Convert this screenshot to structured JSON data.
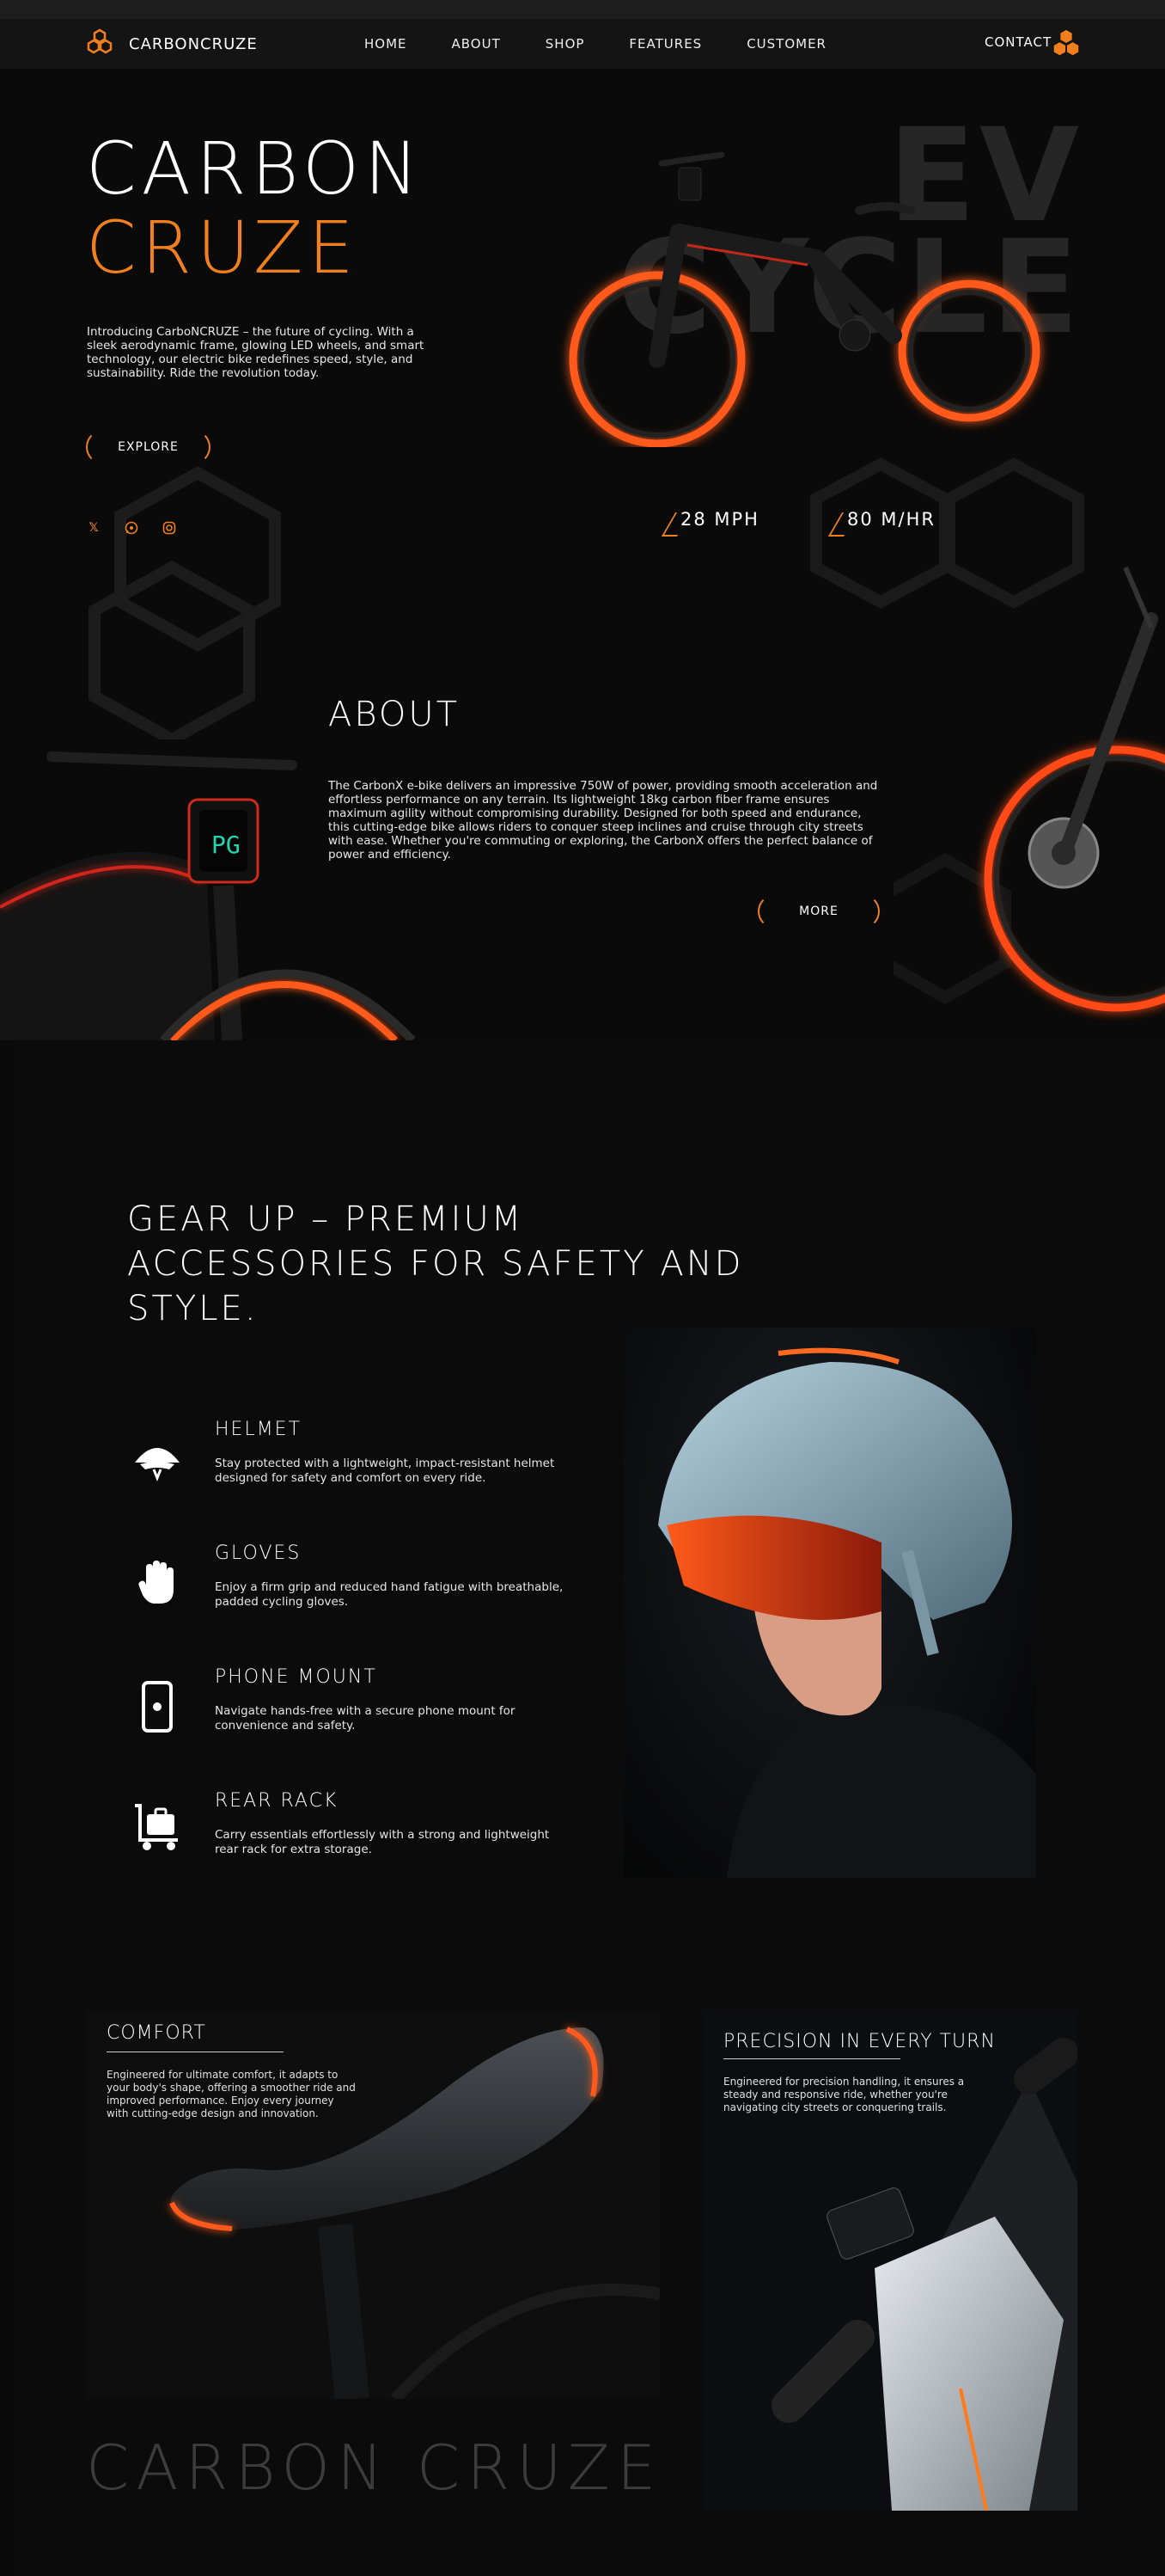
{
  "nav": {
    "brand": "CARBONCRUZE",
    "links": [
      "HOME",
      "ABOUT",
      "SHOP",
      "FEATURES",
      "CUSTOMER"
    ],
    "contact": "CONTACT"
  },
  "hero": {
    "title_line1": "CARBON",
    "title_line2": "CRUZE",
    "description": "Introducing CarboNCRUZE – the future of cycling. With a sleek aerodynamic frame, glowing LED wheels, and smart technology, our electric bike redefines speed, style, and sustainability. Ride the revolution today.",
    "explore_label": "EXPLORE",
    "bg_word_line1": "EV",
    "bg_word_line2": "CYCLE",
    "stats": [
      "28 MPH",
      "80 M/HR"
    ],
    "socials": [
      "x-icon",
      "whatsapp-icon",
      "instagram-icon"
    ]
  },
  "about": {
    "title": "ABOUT",
    "description": "The CarbonX e-bike delivers an impressive 750W of power, providing smooth acceleration and effortless performance on any terrain. Its lightweight 18kg carbon fiber frame ensures maximum agility without compromising durability. Designed for both speed and endurance, this cutting-edge bike allows riders to conquer steep inclines and cruise through city streets with ease. Whether you're commuting or exploring, the CarbonX offers the perfect balance of power and efficiency.",
    "more_label": "MORE",
    "display_text": "PG"
  },
  "gear": {
    "title": "GEAR UP – PREMIUM ACCESSORIES FOR SAFETY AND STYLE.",
    "items": [
      {
        "title": "HELMET",
        "desc": "Stay protected with a lightweight, impact-resistant helmet designed for safety and comfort on every ride.",
        "icon": "helmet-icon"
      },
      {
        "title": "GLOVES",
        "desc": "Enjoy a firm grip and reduced hand fatigue with breathable, padded cycling gloves.",
        "icon": "glove-icon"
      },
      {
        "title": "PHONE MOUNT",
        "desc": "Navigate hands-free with a secure phone mount for convenience and safety.",
        "icon": "phone-icon"
      },
      {
        "title": "REAR RACK",
        "desc": "Carry essentials effortlessly with a strong and lightweight rear rack for extra storage.",
        "icon": "luggage-cart-icon"
      }
    ]
  },
  "cards": {
    "comfort": {
      "title": "COMFORT",
      "desc": "Engineered for ultimate comfort, it adapts to your body's shape, offering a smoother ride and improved performance. Enjoy every journey with cutting-edge design and innovation."
    },
    "precision": {
      "title": "PRECISION IN EVERY TURN",
      "desc": "Engineered for precision handling, it ensures a steady and responsive ride, whether you're navigating city streets or conquering trails."
    }
  },
  "footer": {
    "brand": "CARBON CRUZE"
  },
  "colors": {
    "accent": "#f07f1e",
    "background": "#0a0a0a",
    "glow": "#ff4a14"
  }
}
